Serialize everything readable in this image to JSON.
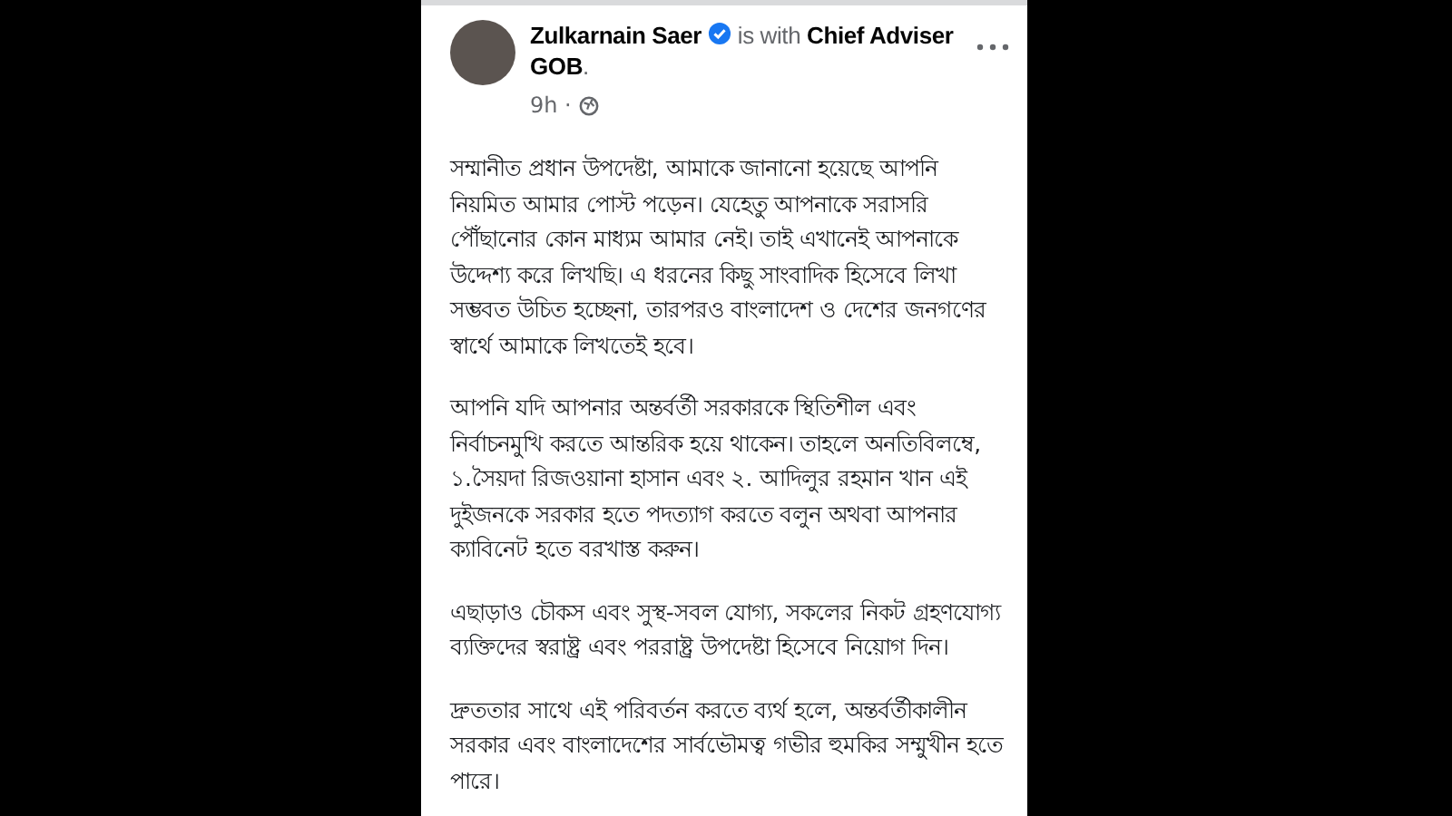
{
  "post": {
    "author": "Zulkarnain Saer",
    "verified": true,
    "with_text": [
      "is with **Chief Adviser**",
      "**GOB**."
    ],
    "time": "9h ·",
    "paragraphs": [
      "সম্মানীত প্রধান উপদেষ্টা, আমাকে জানানো হয়েছে আপনি নিয়মিত আমার পোস্ট পড়েন। যেহেতু আপনাকে সরাসরি পৌঁছানোর কোন মাধ্যম আমার নেই। তাই এখানেই আপনাকে উদ্দেশ্য করে লিখছি। এ ধরনের কিছু সাংবাদিক হিসেবে লিখা সম্ভবত উচিত হচ্ছেনা, তারপরও বাংলাদেশ ও দেশের জনগণের স্বার্থে আমাকে লিখতেই হবে।",
      "আপনি যদি আপনার অন্তর্বর্তী সরকারকে স্থিতিশীল এবং নির্বাচনমুখি করতে আন্তরিক হয়ে থাকেন। তাহলে অনতিবিলম্বে, ১.সৈয়দা রিজওয়ানা হাসান এবং ২. আদিলুর রহমান খান এই দুইজনকে সরকার হতে পদত্যাগ করতে বলুন অথবা আপনার ক্যাবিনেট হতে বরখাস্ত করুন।",
      "এছাড়াও চৌকস এবং সুস্থ-সবল যোগ্য, সকলের নিকট গ্রহণযোগ্য ব্যক্তিদের স্বরাষ্ট্র এবং পররাষ্ট্র উপদেষ্টা হিসেবে নিয়োগ দিন।",
      "দ্রুততার সাথে এই পরিবর্তন করতে ব্যর্থ হলে, অন্তর্বর্তীকালীন সরকার এবং বাংলাদেশের সার্বভৌমত্ব গভীর হুমকির সম্মুখীন হতে পারে।"
    ]
  }
}
